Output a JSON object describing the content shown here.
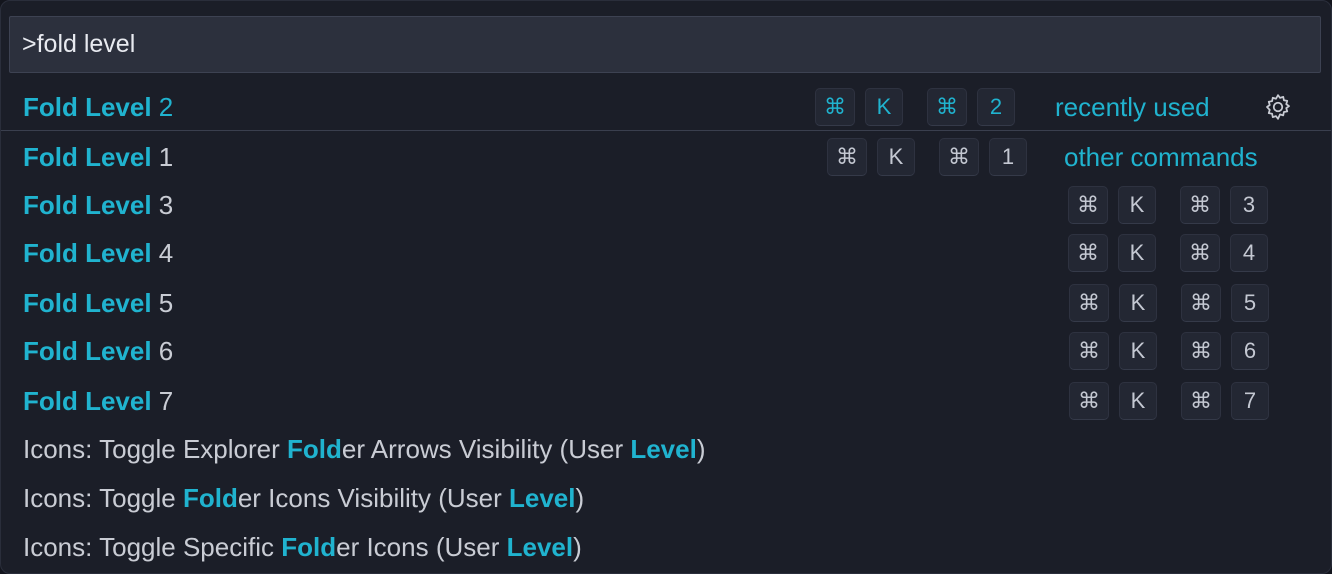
{
  "search": {
    "value": ">fold level"
  },
  "colors": {
    "accent": "#20b3cf",
    "text": "#c9ccd4",
    "background": "#1b1e28"
  },
  "items": [
    {
      "match": "Fold Level",
      "rest": " 2",
      "keys": [
        "⌘",
        "K",
        "⌘",
        "2"
      ],
      "badge": "recently used",
      "icon": "gear-icon"
    },
    {
      "match": "Fold Level",
      "rest": " 1",
      "keys": [
        "⌘",
        "K",
        "⌘",
        "1"
      ],
      "badge": "other commands"
    },
    {
      "match": "Fold Level",
      "rest": " 3",
      "keys": [
        "⌘",
        "K",
        "⌘",
        "3"
      ]
    },
    {
      "match": "Fold Level",
      "rest": " 4",
      "keys": [
        "⌘",
        "K",
        "⌘",
        "4"
      ]
    },
    {
      "match": "Fold Level",
      "rest": " 5",
      "keys": [
        "⌘",
        "K",
        "⌘",
        "5"
      ]
    },
    {
      "match": "Fold Level",
      "rest": " 6",
      "keys": [
        "⌘",
        "K",
        "⌘",
        "6"
      ]
    },
    {
      "match": "Fold Level",
      "rest": " 7",
      "keys": [
        "⌘",
        "K",
        "⌘",
        "7"
      ]
    },
    {
      "parts": [
        "Icons: Toggle Explorer ",
        "Fold",
        "er Arrows Visibility (User ",
        "Level",
        ")"
      ]
    },
    {
      "parts": [
        "Icons: Toggle ",
        "Fold",
        "er Icons Visibility (User ",
        "Level",
        ")"
      ]
    },
    {
      "parts": [
        "Icons: Toggle Specific ",
        "Fold",
        "er Icons (User ",
        "Level",
        ")"
      ]
    }
  ]
}
